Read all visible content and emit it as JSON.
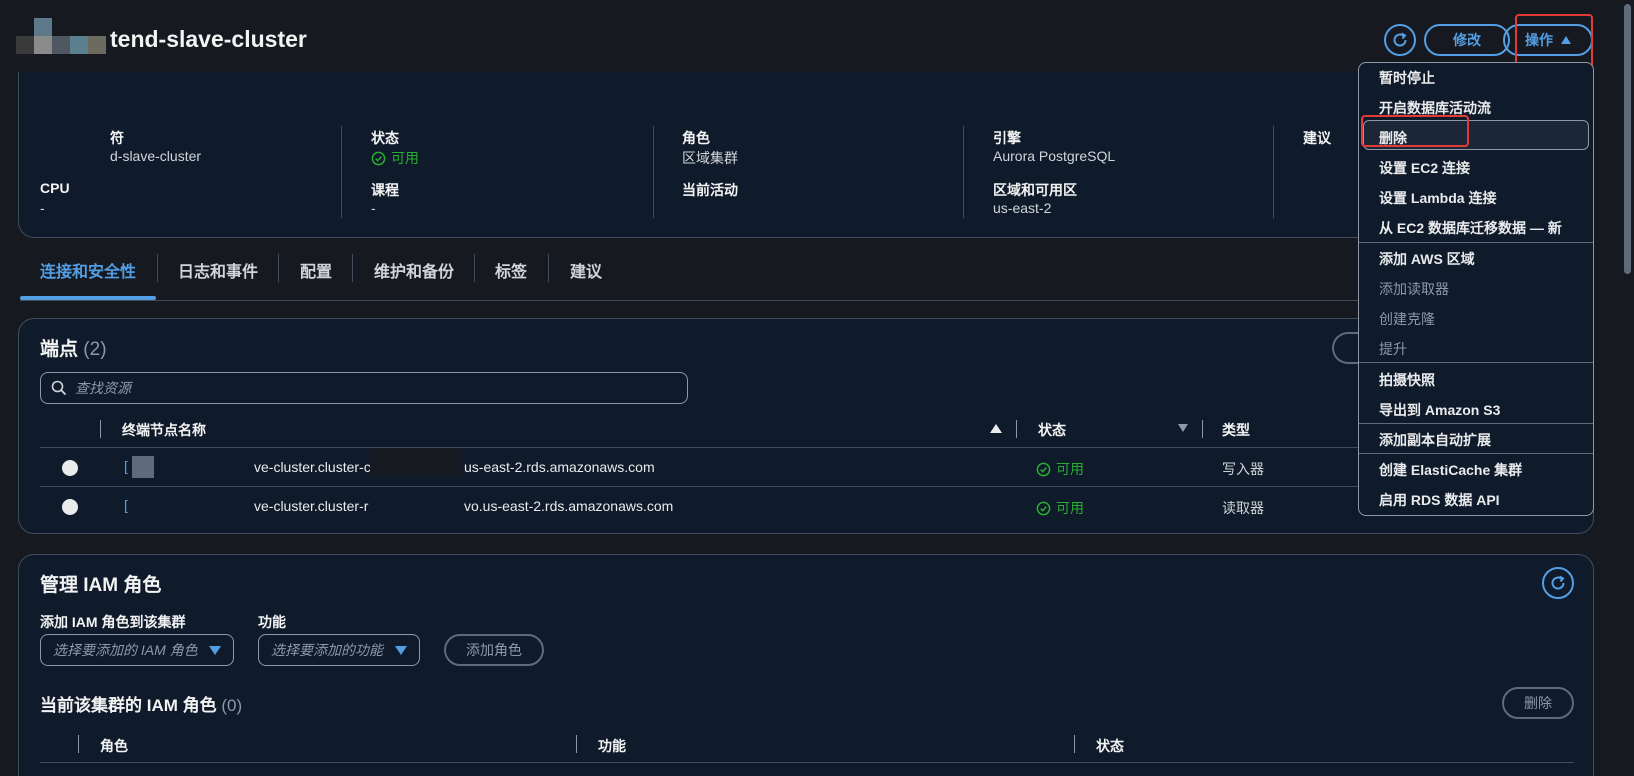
{
  "header": {
    "title": "tend-slave-cluster",
    "refresh_icon": "refresh-icon",
    "modify_label": "修改",
    "actions_label": "操作"
  },
  "summary": {
    "identifier_label": "符",
    "identifier_value": "d-slave-cluster",
    "cpu_label": "CPU",
    "cpu_value": "-",
    "status_label": "状态",
    "status_value": "可用",
    "course_label": "课程",
    "course_value": "-",
    "role_label": "角色",
    "role_value": "区域集群",
    "activity_label": "当前活动",
    "engine_label": "引擎",
    "engine_value": "Aurora PostgreSQL",
    "region_label": "区域和可用区",
    "region_value": "us-east-2",
    "recommend_label": "建议"
  },
  "tabs": [
    "连接和安全性",
    "日志和事件",
    "配置",
    "维护和备份",
    "标签",
    "建议"
  ],
  "endpoints": {
    "title": "端点",
    "count": "(2)",
    "search_placeholder": "查找资源",
    "columns": [
      "终端节点名称",
      "状态",
      "类型"
    ],
    "rows": [
      {
        "prefix": "[",
        "name_mid": "ve-cluster.cluster-c",
        "name_end": "us-east-2.rds.amazonaws.com",
        "status": "可用",
        "type": "写入器"
      },
      {
        "prefix": "[",
        "name_mid": "ve-cluster.cluster-r",
        "name_end": "vo.us-east-2.rds.amazonaws.com",
        "status": "可用",
        "type": "读取器"
      }
    ]
  },
  "iam": {
    "title": "管理 IAM 角色",
    "add_label": "添加 IAM 角色到该集群",
    "feature_label": "功能",
    "role_placeholder": "选择要添加的 IAM 角色",
    "feature_placeholder": "选择要添加的功能",
    "add_button": "添加角色",
    "current_title": "当前该集群的 IAM 角色",
    "current_count": "(0)",
    "delete_button": "删除",
    "columns": [
      "角色",
      "功能",
      "状态"
    ]
  },
  "menu": {
    "items": [
      {
        "label": "暂时停止",
        "disabled": false
      },
      {
        "label": "开启数据库活动流",
        "disabled": false
      },
      {
        "label": "删除",
        "disabled": false
      },
      {
        "label": "设置 EC2 连接",
        "disabled": false
      },
      {
        "label": "设置 Lambda 连接",
        "disabled": false
      },
      {
        "label": "从 EC2 数据库迁移数据 — 新",
        "disabled": false
      },
      {
        "label": "添加 AWS 区域",
        "disabled": false
      },
      {
        "label": "添加读取器",
        "disabled": true
      },
      {
        "label": "创建克隆",
        "disabled": true
      },
      {
        "label": "提升",
        "disabled": true
      },
      {
        "label": "拍摄快照",
        "disabled": false
      },
      {
        "label": "导出到 Amazon S3",
        "disabled": false
      },
      {
        "label": "添加副本自动扩展",
        "disabled": false
      },
      {
        "label": "创建 ElastiCache 集群",
        "disabled": false
      },
      {
        "label": "启用 RDS 数据 API",
        "disabled": false
      }
    ]
  },
  "colors": {
    "accent": "#539fe5",
    "success": "#29ad32",
    "highlight": "#e53935",
    "background": "#16191f"
  }
}
